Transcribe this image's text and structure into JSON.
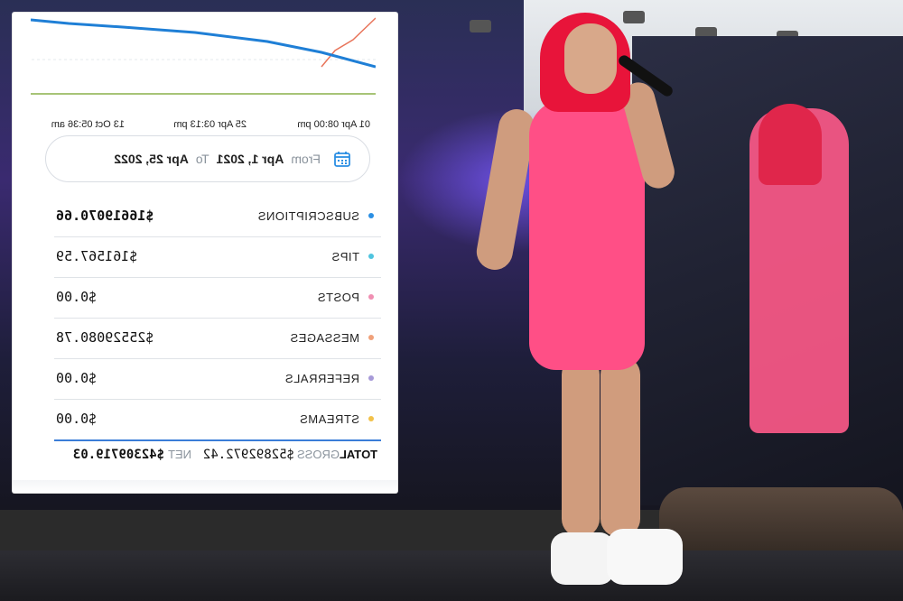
{
  "chart": {
    "x_labels": [
      "01 Apr 08:00 pm",
      "25 Apr 03:13 pm",
      "13 Oct 05:36 am"
    ],
    "series_colors": [
      "#1f7fd6",
      "#e8745a",
      "#8ab04a"
    ]
  },
  "date_range": {
    "from_label": "From",
    "from_value": "Apr 1, 2021",
    "to_label": "To",
    "to_value": "Apr 25, 2022",
    "calendar_icon": "calendar-icon"
  },
  "earnings": [
    {
      "label": "SUBSCRIPTIONS",
      "value": "$16619070.66",
      "color": "#2b8fe3",
      "bold": true
    },
    {
      "label": "TIPS",
      "value": "$161567.59",
      "color": "#4fc4df",
      "bold": false
    },
    {
      "label": "POSTS",
      "value": "$0.00",
      "color": "#f08fb2",
      "bold": false
    },
    {
      "label": "MESSAGES",
      "value": "$25529080.78",
      "color": "#f0a17a",
      "bold": false
    },
    {
      "label": "REFERRALS",
      "value": "$0.00",
      "color": "#a79ad8",
      "bold": false
    },
    {
      "label": "STREAMS",
      "value": "$0.00",
      "color": "#f2c14a",
      "bold": false
    }
  ],
  "totals": {
    "total_label": "TOTAL",
    "gross_label": "GROSS",
    "gross_value": "$52892972.42",
    "net_label": "NET",
    "net_value": "$42309719.03"
  }
}
